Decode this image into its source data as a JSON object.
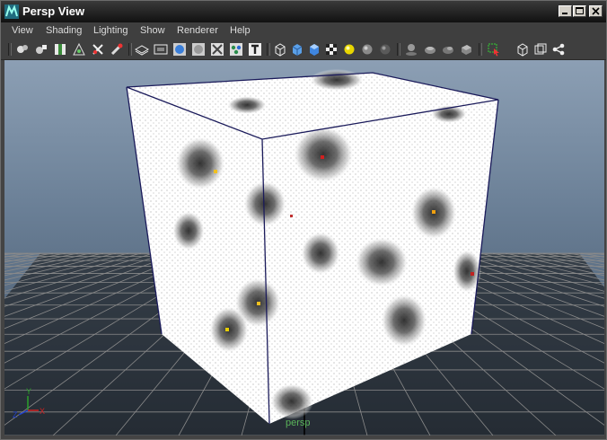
{
  "window": {
    "title": "Persp View"
  },
  "menu": [
    "View",
    "Shading",
    "Lighting",
    "Show",
    "Renderer",
    "Help"
  ],
  "toolbar": {
    "groups": [
      [
        "camera-attributes-icon",
        "bookmark-icon",
        "image-plane-icon",
        "grid-view-icon",
        "pivot-icon",
        "film-gate-icon"
      ],
      [
        "wireframe-icon",
        "resolution-gate-icon",
        "smooth-shade-icon",
        "flat-shade-icon",
        "xray-icon",
        "textured-icon",
        "text-icon"
      ],
      [
        "cube-wire-icon",
        "cube-shaded-icon",
        "cube-lit-icon",
        "checker-icon",
        "default-light-icon",
        "sphere-icon",
        "sphere-dark-icon"
      ],
      [
        "shadow-icon",
        "ambient-occlusion-icon",
        "motion-blur-icon",
        "depth-of-field-icon"
      ],
      [
        "select-camera-icon",
        "isolate-select-icon",
        "frame-all-icon",
        "hierarchy-icon"
      ]
    ]
  },
  "viewport": {
    "camera_label": "persp",
    "axis": {
      "x": "X",
      "y": "Y",
      "z": "Z"
    }
  }
}
